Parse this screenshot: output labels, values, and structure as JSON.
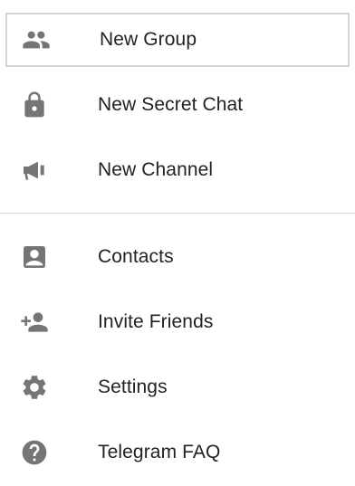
{
  "menu": {
    "items": [
      {
        "label": "New Group",
        "icon": "group-icon",
        "selected": true
      },
      {
        "label": "New Secret Chat",
        "icon": "lock-icon"
      },
      {
        "label": "New Channel",
        "icon": "megaphone-icon"
      },
      {
        "label": "Contacts",
        "icon": "contact-card-icon"
      },
      {
        "label": "Invite Friends",
        "icon": "add-person-icon"
      },
      {
        "label": "Settings",
        "icon": "gear-icon"
      },
      {
        "label": "Telegram FAQ",
        "icon": "help-icon"
      }
    ]
  },
  "colors": {
    "icon": "#757575",
    "text": "#222222",
    "divider": "#dcdcdc",
    "selected_border": "#d4d4d4"
  }
}
